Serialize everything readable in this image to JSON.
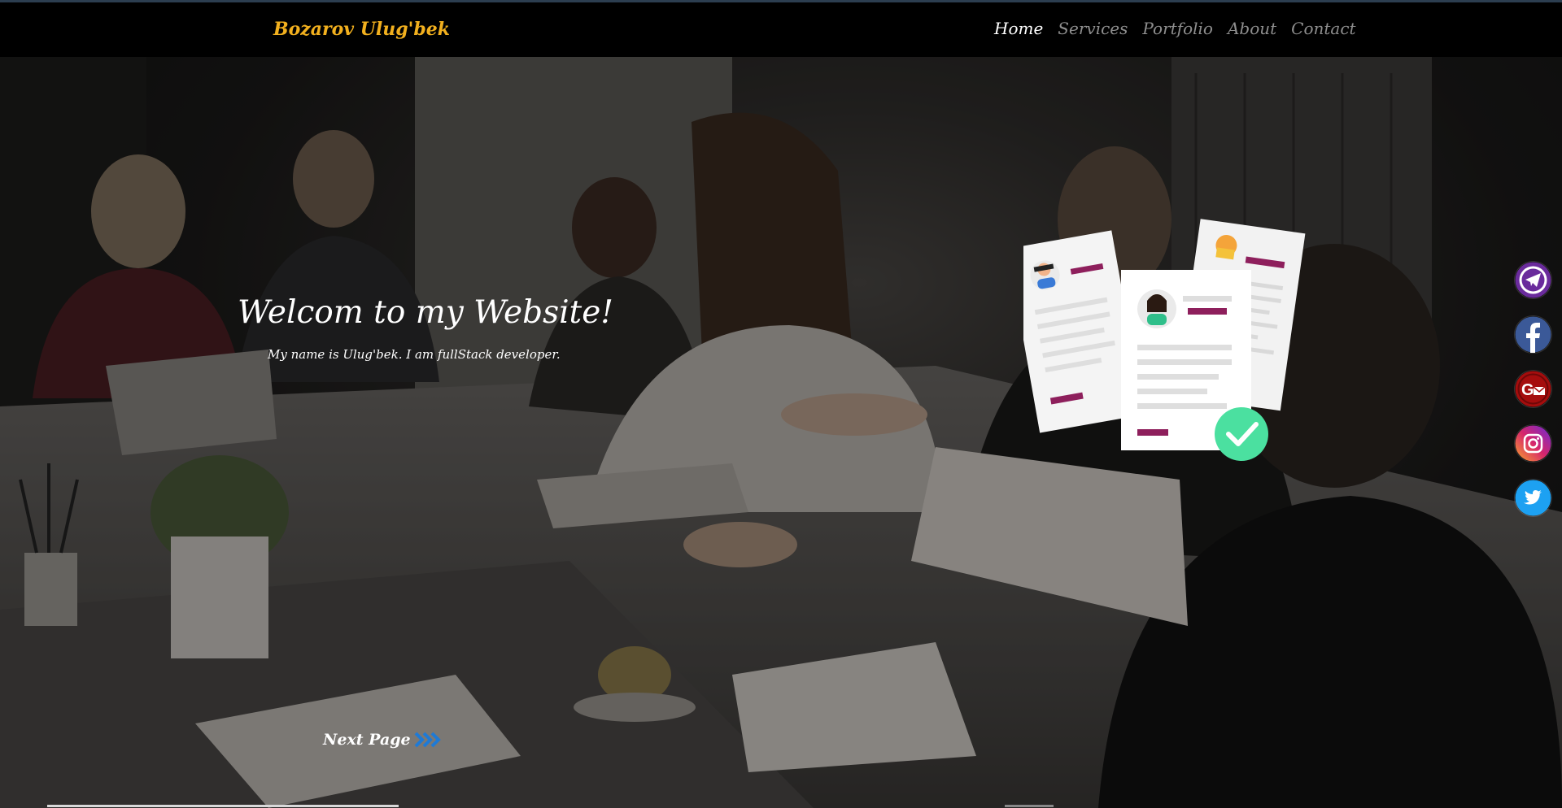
{
  "nav": {
    "brand": "Bozarov Ulug'bek",
    "items": [
      {
        "label": "Home",
        "active": true
      },
      {
        "label": "Services",
        "active": false
      },
      {
        "label": "Portfolio",
        "active": false
      },
      {
        "label": "About",
        "active": false
      },
      {
        "label": "Contact",
        "active": false
      }
    ]
  },
  "hero": {
    "title": "Welcom to my Website!",
    "subtitle": "My name is Ulug'bek. I am fullStack developer.",
    "next_label": "Next Page"
  },
  "social": [
    {
      "name": "telegram-icon",
      "color": "#6a2b9c"
    },
    {
      "name": "facebook-icon",
      "color": "#3b5998"
    },
    {
      "name": "gmail-icon",
      "color": "#a50d0d"
    },
    {
      "name": "instagram-icon",
      "color": "#c13584"
    },
    {
      "name": "twitter-icon",
      "color": "#1da1f2"
    }
  ],
  "colors": {
    "brand": "#f2b01e",
    "nav_active": "#ffffff",
    "nav_inactive": "#8e8e8e",
    "accent_check": "#4be0a0",
    "resume_accent": "#8e1f5c"
  }
}
